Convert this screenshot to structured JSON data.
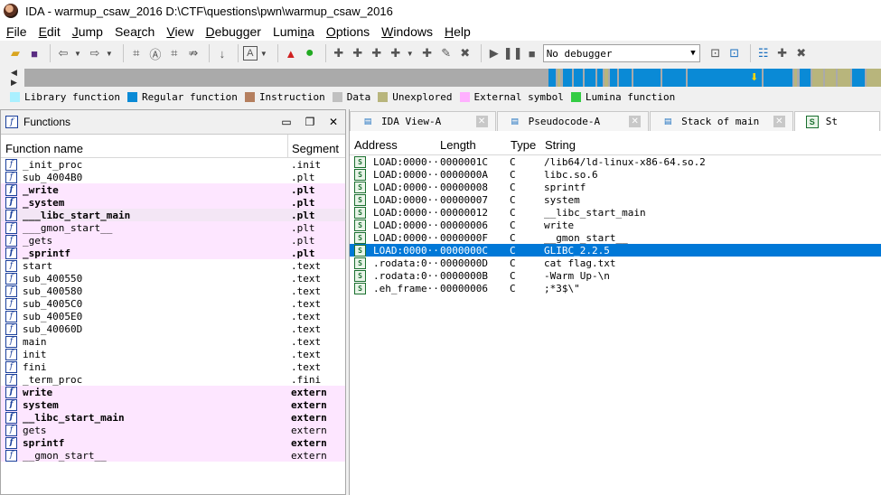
{
  "window": {
    "title": "IDA - warmup_csaw_2016 D:\\CTF\\questions\\pwn\\warmup_csaw_2016"
  },
  "menu": [
    "File",
    "Edit",
    "Jump",
    "Search",
    "View",
    "Debugger",
    "Lumina",
    "Options",
    "Windows",
    "Help"
  ],
  "toolbar": {
    "debugger_select": "No debugger"
  },
  "legend": [
    {
      "label": "Library function",
      "color": "#aaf0ff"
    },
    {
      "label": "Regular function",
      "color": "#0a8ad6"
    },
    {
      "label": "Instruction",
      "color": "#b57f5f"
    },
    {
      "label": "Data",
      "color": "#c0c0c0"
    },
    {
      "label": "Unexplored",
      "color": "#b8b57c"
    },
    {
      "label": "External symbol",
      "color": "#ffb0ff"
    },
    {
      "label": "Lumina function",
      "color": "#33cc44"
    }
  ],
  "functions_panel": {
    "title": "Functions",
    "col_name": "Function name",
    "col_segment": "Segment",
    "rows": [
      {
        "name": "_init_proc",
        "segment": ".init",
        "pink": false,
        "bold": false
      },
      {
        "name": "sub_4004B0",
        "segment": ".plt",
        "pink": false,
        "bold": false
      },
      {
        "name": "_write",
        "segment": ".plt",
        "pink": true,
        "bold": true
      },
      {
        "name": "_system",
        "segment": ".plt",
        "pink": true,
        "bold": true
      },
      {
        "name": "___libc_start_main",
        "segment": ".plt",
        "pink": true,
        "bold": true
      },
      {
        "name": "___gmon_start__",
        "segment": ".plt",
        "pink": true,
        "bold": false
      },
      {
        "name": "_gets",
        "segment": ".plt",
        "pink": true,
        "bold": false
      },
      {
        "name": "_sprintf",
        "segment": ".plt",
        "pink": true,
        "bold": true
      },
      {
        "name": "start",
        "segment": ".text",
        "pink": false,
        "bold": false
      },
      {
        "name": "sub_400550",
        "segment": ".text",
        "pink": false,
        "bold": false
      },
      {
        "name": "sub_400580",
        "segment": ".text",
        "pink": false,
        "bold": false
      },
      {
        "name": "sub_4005C0",
        "segment": ".text",
        "pink": false,
        "bold": false
      },
      {
        "name": "sub_4005E0",
        "segment": ".text",
        "pink": false,
        "bold": false
      },
      {
        "name": "sub_40060D",
        "segment": ".text",
        "pink": false,
        "bold": false
      },
      {
        "name": "main",
        "segment": ".text",
        "pink": false,
        "bold": false
      },
      {
        "name": "init",
        "segment": ".text",
        "pink": false,
        "bold": false
      },
      {
        "name": "fini",
        "segment": ".text",
        "pink": false,
        "bold": false
      },
      {
        "name": "_term_proc",
        "segment": ".fini",
        "pink": false,
        "bold": false
      },
      {
        "name": "write",
        "segment": "extern",
        "pink": true,
        "bold": true
      },
      {
        "name": "system",
        "segment": "extern",
        "pink": true,
        "bold": true
      },
      {
        "name": "__libc_start_main",
        "segment": "extern",
        "pink": true,
        "bold": true
      },
      {
        "name": "gets",
        "segment": "extern",
        "pink": true,
        "bold": false
      },
      {
        "name": "sprintf",
        "segment": "extern",
        "pink": true,
        "bold": true
      },
      {
        "name": "__gmon_start__",
        "segment": "extern",
        "pink": true,
        "bold": false
      }
    ]
  },
  "tabs": [
    {
      "label": "IDA View-A",
      "icon": "ida-view-icon"
    },
    {
      "label": "Pseudocode-A",
      "icon": "pseudocode-icon"
    },
    {
      "label": "Stack of main",
      "icon": "stack-icon"
    },
    {
      "label": "St",
      "icon": "strings-icon"
    }
  ],
  "strings_panel": {
    "col_address": "Address",
    "col_length": "Length",
    "col_type": "Type",
    "col_string": "String",
    "rows": [
      {
        "address": "LOAD:0000···",
        "length": "0000001C",
        "type": "C",
        "string": "/lib64/ld-linux-x86-64.so.2"
      },
      {
        "address": "LOAD:0000···",
        "length": "0000000A",
        "type": "C",
        "string": "libc.so.6"
      },
      {
        "address": "LOAD:0000···",
        "length": "00000008",
        "type": "C",
        "string": "sprintf"
      },
      {
        "address": "LOAD:0000···",
        "length": "00000007",
        "type": "C",
        "string": "system"
      },
      {
        "address": "LOAD:0000···",
        "length": "00000012",
        "type": "C",
        "string": "__libc_start_main"
      },
      {
        "address": "LOAD:0000···",
        "length": "00000006",
        "type": "C",
        "string": "write"
      },
      {
        "address": "LOAD:0000···",
        "length": "0000000F",
        "type": "C",
        "string": "__gmon_start__"
      },
      {
        "address": "LOAD:0000···",
        "length": "0000000C",
        "type": "C",
        "string": "GLIBC_2.2.5"
      },
      {
        "address": ".rodata:0···",
        "length": "0000000D",
        "type": "C",
        "string": "cat flag.txt"
      },
      {
        "address": ".rodata:0···",
        "length": "0000000B",
        "type": "C",
        "string": "-Warm Up-\\n"
      },
      {
        "address": ".eh_frame···",
        "length": "00000006",
        "type": "C",
        "string": ";*3$\\\""
      }
    ],
    "selected_index": 7
  }
}
